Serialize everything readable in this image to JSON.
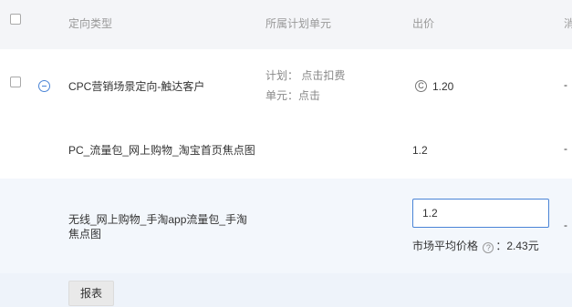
{
  "header": {
    "type_label": "定向类型",
    "unit_label": "所属计划单元",
    "bid_label": "出价",
    "extra_label": "消"
  },
  "rows": [
    {
      "name": "CPC营销场景定向-触达客户",
      "plan_label": "计划：",
      "plan_value": "点击扣费",
      "unit_label": "单元：",
      "unit_value": "点击",
      "coin_glyph": "C",
      "bid": "1.20",
      "dash": "-"
    },
    {
      "name": "PC_流量包_网上购物_淘宝首页焦点图",
      "bid": "1.2",
      "dash": "-"
    },
    {
      "name_line1": "无线_网上购物_手淘app流量包_手淘",
      "name_line2": "焦点图",
      "bid_input": "1.2",
      "market_label": "市场平均价格",
      "market_value": "：2.43元",
      "help_glyph": "?",
      "dash": "-"
    }
  ],
  "footer": {
    "report_button": "报表"
  }
}
